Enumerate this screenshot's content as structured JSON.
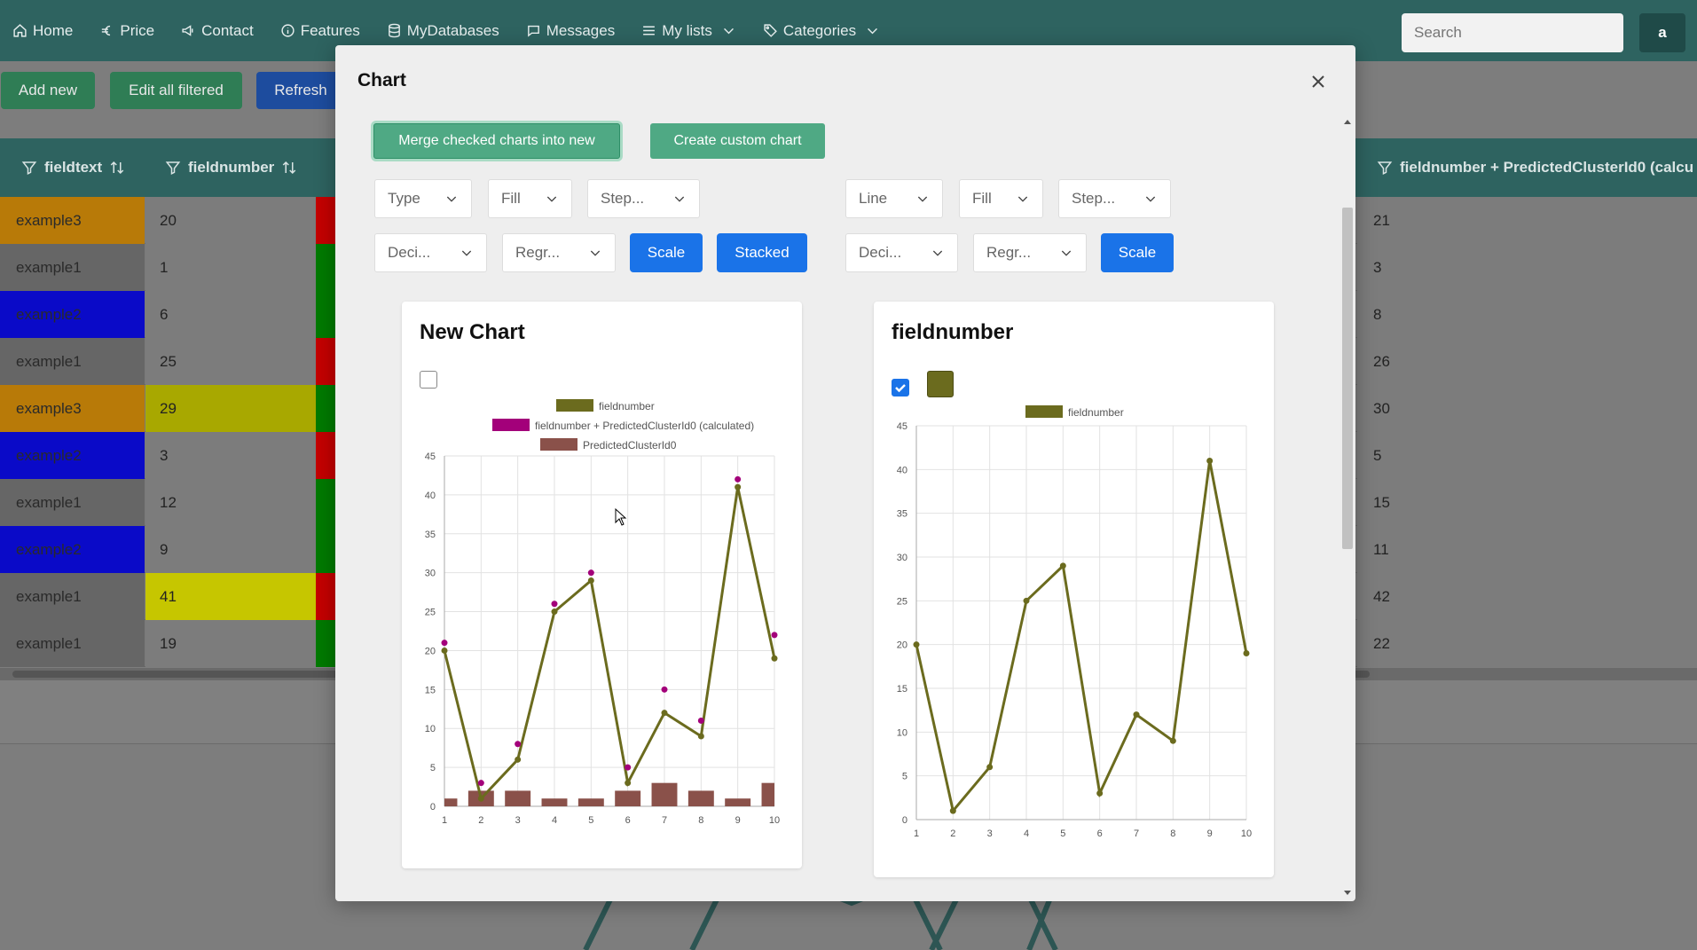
{
  "nav": {
    "items": [
      {
        "label": "Home",
        "icon": "home-icon"
      },
      {
        "label": "Price",
        "icon": "euro-icon"
      },
      {
        "label": "Contact",
        "icon": "megaphone-icon"
      },
      {
        "label": "Features",
        "icon": "info-icon"
      },
      {
        "label": "MyDatabases",
        "icon": "database-icon"
      },
      {
        "label": "Messages",
        "icon": "chat-icon"
      },
      {
        "label": "My lists",
        "icon": "list-icon"
      },
      {
        "label": "Categories",
        "icon": "tag-icon"
      }
    ],
    "search_placeholder": "Search",
    "avatar": "a"
  },
  "toolbar": {
    "add_new": "Add new",
    "edit_all_filtered": "Edit all filtered",
    "refresh": "Refresh"
  },
  "table": {
    "headers": [
      "fieldtext",
      "fieldnumber",
      "fieldnumber + PredictedClusterId0 (calcu"
    ],
    "rows": [
      {
        "text": "example3",
        "number": "20",
        "calc": "21",
        "text_color": "#b87a08",
        "number_color": "#7c7c7c",
        "flag_color": "#c40000"
      },
      {
        "text": "example1",
        "number": "1",
        "calc": "3",
        "text_color": "#666666",
        "number_color": "#7c7c7c",
        "flag_color": "#007a00"
      },
      {
        "text": "example2",
        "number": "6",
        "calc": "8",
        "text_color": "#0a0ac8",
        "number_color": "#7c7c7c",
        "flag_color": "#007a00"
      },
      {
        "text": "example1",
        "number": "25",
        "calc": "26",
        "text_color": "#666666",
        "number_color": "#7c7c7c",
        "flag_color": "#c40000"
      },
      {
        "text": "example3",
        "number": "29",
        "calc": "30",
        "text_color": "#b87a08",
        "number_color": "#a8a800",
        "flag_color": "#007a00"
      },
      {
        "text": "example2",
        "number": "3",
        "calc": "5",
        "text_color": "#0a0ac8",
        "number_color": "#7c7c7c",
        "flag_color": "#c40000"
      },
      {
        "text": "example1",
        "number": "12",
        "calc": "15",
        "text_color": "#666666",
        "number_color": "#7c7c7c",
        "flag_color": "#007a00"
      },
      {
        "text": "example2",
        "number": "9",
        "calc": "11",
        "text_color": "#0a0ac8",
        "number_color": "#7c7c7c",
        "flag_color": "#007a00"
      },
      {
        "text": "example1",
        "number": "41",
        "calc": "42",
        "text_color": "#666666",
        "number_color": "#c6c600",
        "flag_color": "#c40000"
      },
      {
        "text": "example1",
        "number": "19",
        "calc": "22",
        "text_color": "#666666",
        "number_color": "#7c7c7c",
        "flag_color": "#007a00"
      }
    ]
  },
  "modal": {
    "title": "Chart",
    "merge_button": "Merge checked charts into new",
    "custom_button": "Create custom chart",
    "left_controls": {
      "type": "Type",
      "fill": "Fill",
      "step": "Step...",
      "deci": "Deci...",
      "regr": "Regr...",
      "scale": "Scale",
      "stacked": "Stacked"
    },
    "right_controls": {
      "type": "Line",
      "fill": "Fill",
      "step": "Step...",
      "deci": "Deci...",
      "regr": "Regr...",
      "scale": "Scale"
    }
  },
  "chart_data": [
    {
      "title": "New Chart",
      "checked": false,
      "type": "line",
      "x": [
        1,
        2,
        3,
        4,
        5,
        6,
        7,
        8,
        9,
        10
      ],
      "ylim": [
        0,
        45
      ],
      "yticks": [
        0,
        5,
        10,
        15,
        20,
        25,
        30,
        35,
        40,
        45
      ],
      "grid": true,
      "legend_position": "top",
      "series": [
        {
          "name": "fieldnumber",
          "type": "line",
          "color": "#6b6b1e",
          "values": [
            20,
            1,
            6,
            25,
            29,
            3,
            12,
            9,
            41,
            19
          ]
        },
        {
          "name": "fieldnumber + PredictedClusterId0 (calculated)",
          "type": "scatter",
          "color": "#a3007a",
          "values": [
            21,
            3,
            8,
            26,
            30,
            5,
            15,
            11,
            42,
            22
          ]
        },
        {
          "name": "PredictedClusterId0",
          "type": "bar",
          "color": "#8a514a",
          "values": [
            1,
            2,
            2,
            1,
            1,
            2,
            3,
            2,
            1,
            3
          ]
        }
      ]
    },
    {
      "title": "fieldnumber",
      "checked": true,
      "type": "line",
      "x": [
        1,
        2,
        3,
        4,
        5,
        6,
        7,
        8,
        9,
        10
      ],
      "ylim": [
        0,
        45
      ],
      "yticks": [
        0,
        5,
        10,
        15,
        20,
        25,
        30,
        35,
        40,
        45
      ],
      "grid": true,
      "legend_position": "top",
      "swatch_color": "#6b6b1e",
      "series": [
        {
          "name": "fieldnumber",
          "type": "line",
          "color": "#6b6b1e",
          "values": [
            20,
            1,
            6,
            25,
            29,
            3,
            12,
            9,
            41,
            19
          ]
        }
      ]
    }
  ]
}
